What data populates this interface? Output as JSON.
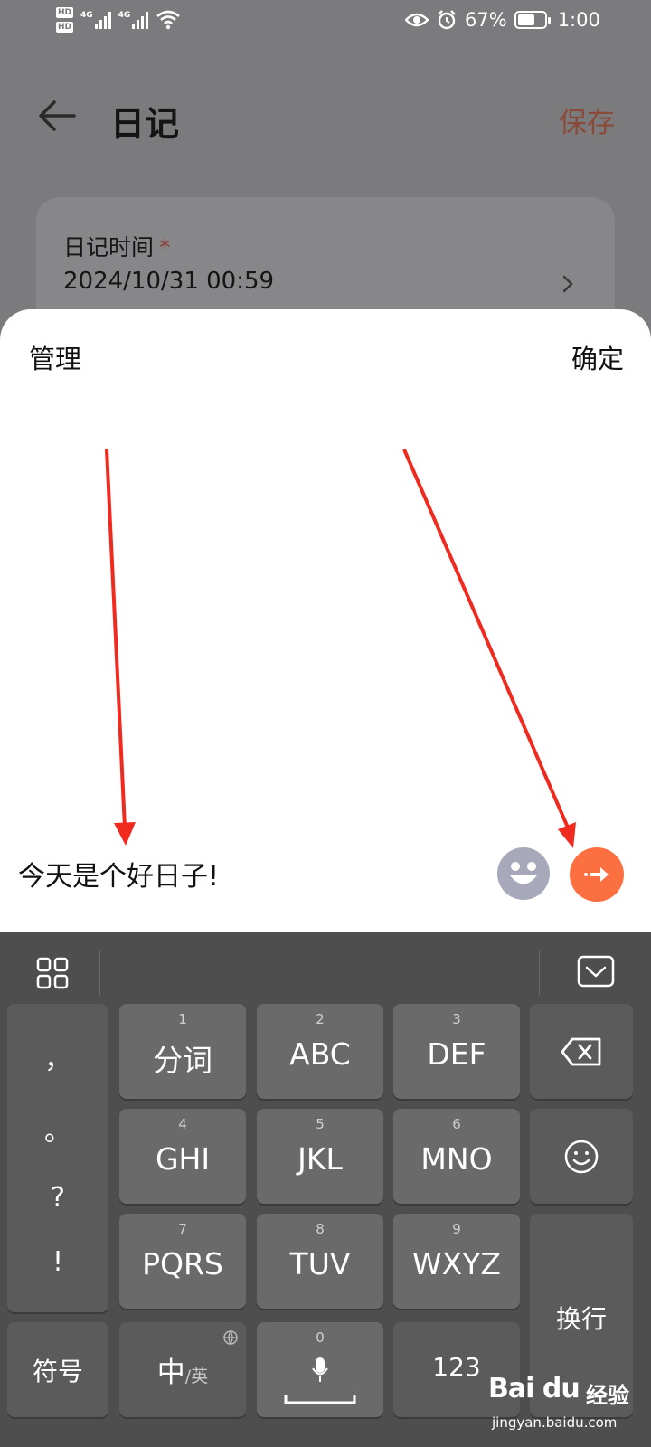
{
  "status_bar": {
    "hd1": "HD",
    "hd2": "HD",
    "net1": "4G",
    "net2": "4G",
    "battery_percent": "67%",
    "battery_level": 0.67,
    "time": "1:00",
    "icons": [
      "eye-icon",
      "alarm-icon",
      "wifi-icon",
      "battery-icon"
    ]
  },
  "header": {
    "title": "日记",
    "save_label": "保存"
  },
  "diary_card": {
    "label": "日记时间",
    "required_mark": "*",
    "datetime": "2024/10/31 00:59"
  },
  "sheet": {
    "manage_label": "管理",
    "confirm_label": "确定",
    "input_text": "今天是个好日子!"
  },
  "colors": {
    "accent": "#fb6f41",
    "save": "#8a4a3a",
    "annotation_arrow": "#f02a1e",
    "keyboard_bg": "#4e4e4e",
    "key_bg": "#6a6a6a"
  },
  "keyboard": {
    "punct_keys": [
      "，",
      "。",
      "?",
      "!"
    ],
    "row1": [
      {
        "num": "1",
        "label": "分词"
      },
      {
        "num": "2",
        "label": "ABC"
      },
      {
        "num": "3",
        "label": "DEF"
      }
    ],
    "row2": [
      {
        "num": "4",
        "label": "GHI"
      },
      {
        "num": "5",
        "label": "JKL"
      },
      {
        "num": "6",
        "label": "MNO"
      }
    ],
    "row3": [
      {
        "num": "7",
        "label": "PQRS"
      },
      {
        "num": "8",
        "label": "TUV"
      },
      {
        "num": "9",
        "label": "WXYZ"
      }
    ],
    "symbol_label": "符号",
    "lang_main": "中",
    "lang_sub": "/英",
    "space_num": "0",
    "numbers_label": "123",
    "enter_label": "换行"
  },
  "watermark": {
    "brand": "Bai du",
    "jy": "经验",
    "url": "jingyan.baidu.com"
  }
}
